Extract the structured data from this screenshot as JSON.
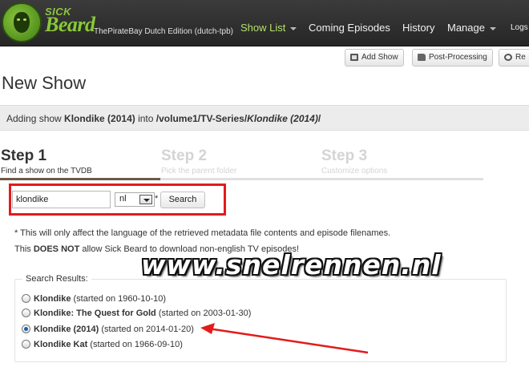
{
  "header": {
    "brand_small": "SICK",
    "brand_large": "Beard",
    "edition": "ThePirateBay Dutch Edition (dutch-tpb)",
    "nav": [
      {
        "label": "Show List",
        "active": true,
        "dropdown": true
      },
      {
        "label": "Coming Episodes",
        "active": false,
        "dropdown": false
      },
      {
        "label": "History",
        "active": false,
        "dropdown": false
      },
      {
        "label": "Manage",
        "active": false,
        "dropdown": true
      },
      {
        "label": "Logs",
        "active": false,
        "dropdown": false
      }
    ]
  },
  "toolbar": {
    "add_show": "Add Show",
    "post_processing": "Post-Processing",
    "restart": "Re"
  },
  "page_title": "New Show",
  "info": {
    "prefix": "Adding show ",
    "show_name": "Klondike (2014)",
    "into": " into ",
    "path_root": "/volume1/TV-Series/",
    "path_show": "Klondike (2014)",
    "path_end": "/"
  },
  "steps": [
    {
      "label": "Step 1",
      "sub": "Find a show on the TVDB",
      "active": true
    },
    {
      "label": "Step 2",
      "sub": "Pick the parent folder",
      "active": false
    },
    {
      "label": "Step 3",
      "sub": "Customize options",
      "active": false
    }
  ],
  "progress_fraction": 1,
  "search": {
    "value": "klondike",
    "language": "nl",
    "asterisk": "*",
    "button": "Search"
  },
  "notes": {
    "line1": "* This will only affect the language of the retrieved metadata file contents and episode filenames.",
    "line2_a": "This ",
    "line2_b": "DOES NOT",
    "line2_c": " allow Sick Beard to download non-english TV episodes!"
  },
  "watermark": "www.snelrennen.nl",
  "results": {
    "legend": "Search Results:",
    "items": [
      {
        "name": "Klondike",
        "started": "(started on 1960-10-10)",
        "checked": false
      },
      {
        "name": "Klondike: The Quest for Gold",
        "started": "(started on 2003-01-30)",
        "checked": false
      },
      {
        "name": "Klondike (2014)",
        "started": "(started on 2014-01-20)",
        "checked": true
      },
      {
        "name": "Klondike Kat",
        "started": "(started on 1966-09-10)",
        "checked": false
      }
    ]
  },
  "colors": {
    "nav_bg": "#2e2e2e",
    "accent_green": "#8cc63e",
    "annotation_red": "#e31b1b",
    "progress": "#6e5a47"
  },
  "icons": {
    "add_show": "tv-icon",
    "post_processing": "folder-icon",
    "restart": "power-icon"
  }
}
